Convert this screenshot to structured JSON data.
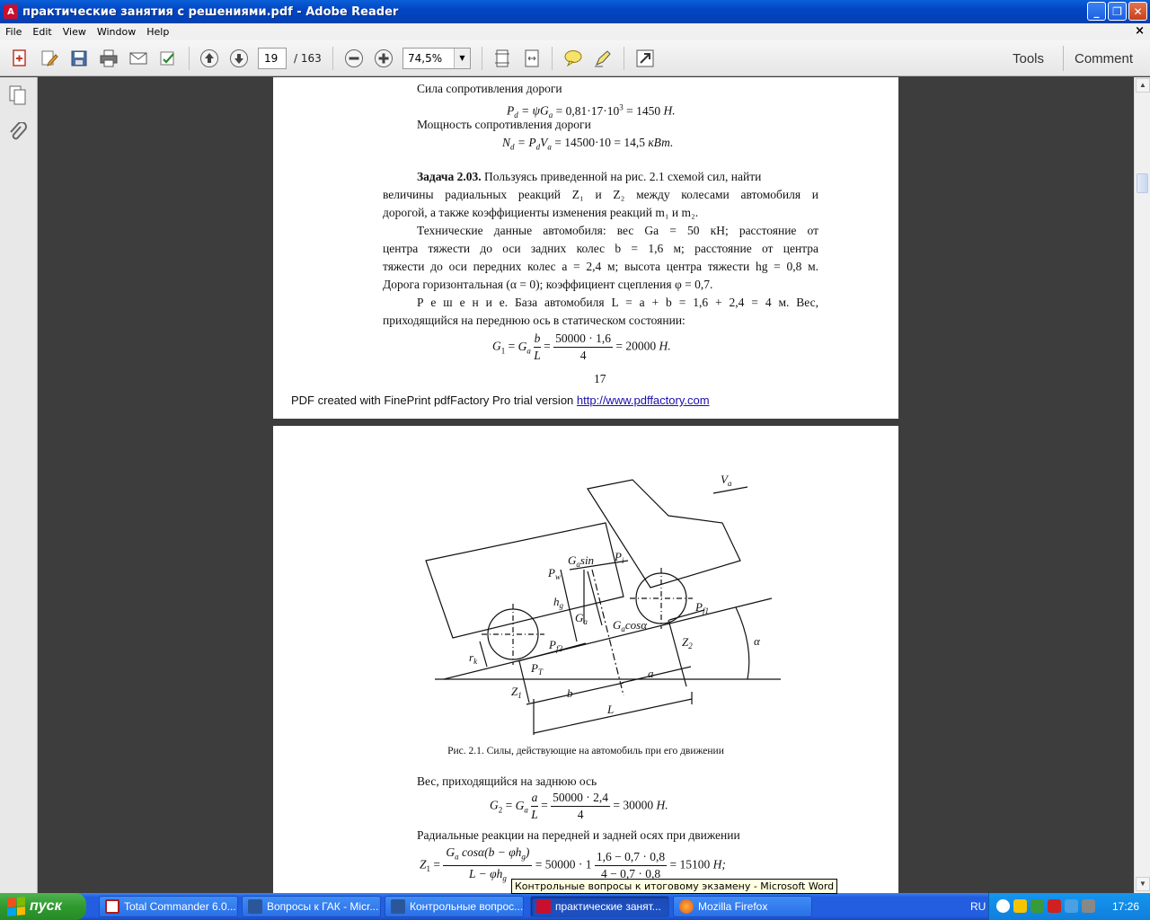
{
  "window": {
    "title": "практические занятия с решениями.pdf - Adobe Reader",
    "app_icon": "adobe-reader-icon"
  },
  "menu": [
    "File",
    "Edit",
    "View",
    "Window",
    "Help"
  ],
  "toolbar": {
    "page_current": "19",
    "page_total": "/ 163",
    "zoom": "74,5%",
    "tools_label": "Tools",
    "comment_label": "Comment"
  },
  "page1": {
    "l1": "Сила сопротивления дороги",
    "l2": "Мощность сопротивления дороги",
    "task_title": "Задача 2.03.",
    "p1a": "Пользуясь  приведенной на рис. 2.1 схемой сил, найти",
    "p1b": "величины радиальных реакций Z₁ и Z₂ между колесами автомобиля и",
    "p1c": "дорогой, а также коэффициенты изменения реакций m₁ и m₂.",
    "p2a": "Технические данные автомобиля: вес Gа = 50 кН; расстояние от",
    "p2b": "центра тяжести до оси задних колес b = 1,6 м; расстояние от центра",
    "p2c": "тяжести до оси передних колес a = 2,4 м; высота центра тяжести hg = 0,8 м.",
    "p2d": "Дорога горизонтальная (α = 0); коэффициент сцепления φ = 0,7.",
    "p3a": "Р е ш е н и е. База автомобиля L = a + b = 1,6 + 2,4 = 4 м. Вес,",
    "p3b": "приходящийся на переднюю ось в статическом состоянии:",
    "page_num": "17",
    "factory_text": "PDF created with FinePrint pdfFactory Pro trial version",
    "factory_link": "http://www.pdffactory.com"
  },
  "page2": {
    "caption": "Рис. 2.1. Силы, действующие на автомобиль при его движении",
    "l1": "Вес, приходящийся на заднюю ось",
    "l2": "Радиальные реакции на передней и задней осях при движении"
  },
  "taskbar": {
    "start": "пуск",
    "tasks": [
      "Total Commander 6.0...",
      "Вопросы к ГАК - Micr...",
      "Контрольные вопрос...",
      "практические занят...",
      "Mozilla Firefox"
    ],
    "lang": "RU",
    "clock": "17:26",
    "tooltip": "Контрольные вопросы к итоговому экзамену - Microsoft Word"
  }
}
